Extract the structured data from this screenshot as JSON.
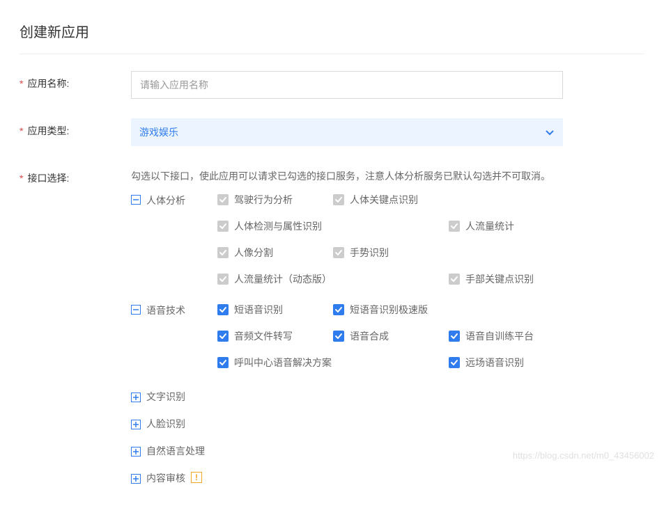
{
  "pageTitle": "创建新应用",
  "fields": {
    "appName": {
      "label": "应用名称:",
      "placeholder": "请输入应用名称"
    },
    "appType": {
      "label": "应用类型:",
      "selected": "游戏娱乐"
    },
    "apiSelect": {
      "label": "接口选择:",
      "description": "勾选以下接口，使此应用可以请求已勾选的接口服务，注意人体分析服务已默认勾选并不可取消。"
    }
  },
  "categories": {
    "body": {
      "label": "人体分析",
      "expanded": true,
      "items": [
        {
          "label": "驾驶行为分析",
          "state": "disabled"
        },
        {
          "label": "人体关键点识别",
          "state": "disabled"
        },
        {
          "label": "人体检测与属性识别",
          "state": "disabled",
          "span": 2
        },
        {
          "label": "人流量统计",
          "state": "disabled"
        },
        {
          "label": "人像分割",
          "state": "disabled"
        },
        {
          "label": "手势识别",
          "state": "disabled"
        },
        {
          "label": "人流量统计（动态版）",
          "state": "disabled",
          "span": 2
        },
        {
          "label": "手部关键点识别",
          "state": "disabled"
        }
      ]
    },
    "speech": {
      "label": "语音技术",
      "expanded": true,
      "items": [
        {
          "label": "短语音识别",
          "state": "checked"
        },
        {
          "label": "短语音识别极速版",
          "state": "checked",
          "span": 2
        },
        {
          "label": "音频文件转写",
          "state": "checked"
        },
        {
          "label": "语音合成",
          "state": "checked"
        },
        {
          "label": "语音自训练平台",
          "state": "checked"
        },
        {
          "label": "呼叫中心语音解决方案",
          "state": "checked",
          "span": 2
        },
        {
          "label": "远场语音识别",
          "state": "checked"
        }
      ]
    },
    "ocr": {
      "label": "文字识别",
      "expanded": false
    },
    "face": {
      "label": "人脸识别",
      "expanded": false
    },
    "nlp": {
      "label": "自然语言处理",
      "expanded": false
    },
    "audit": {
      "label": "内容审核",
      "expanded": false,
      "warn": true
    }
  },
  "watermark": "https://blog.csdn.net/m0_43456002"
}
